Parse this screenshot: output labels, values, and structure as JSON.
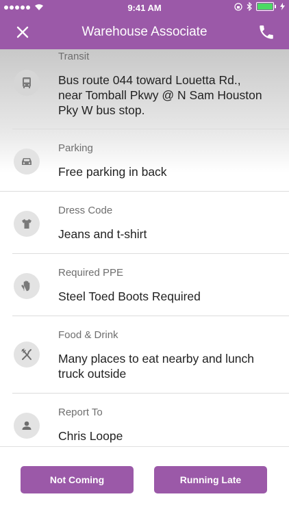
{
  "status_bar": {
    "time": "9:41 AM"
  },
  "nav": {
    "title": "Warehouse Associate"
  },
  "details": [
    {
      "label": "Transit",
      "value": "Bus route 044 toward Louetta Rd., near Tomball Pkwy @ N Sam Houston Pky W bus stop.",
      "icon": "bus-icon"
    },
    {
      "label": "Parking",
      "value": "Free parking in back",
      "icon": "car-icon"
    },
    {
      "label": "Dress Code",
      "value": "Jeans and t-shirt",
      "icon": "tshirt-icon"
    },
    {
      "label": "Required PPE",
      "value": "Steel Toed Boots Required",
      "icon": "glove-icon"
    },
    {
      "label": "Food & Drink",
      "value": "Many places to eat nearby and lunch truck outside",
      "icon": "fork-knife-icon"
    },
    {
      "label": "Report To",
      "value": "Chris Loope",
      "icon": "person-icon"
    }
  ],
  "footer": {
    "not_coming_label": "Not Coming",
    "running_late_label": "Running Late"
  },
  "colors": {
    "brand": "#9b59a8"
  }
}
